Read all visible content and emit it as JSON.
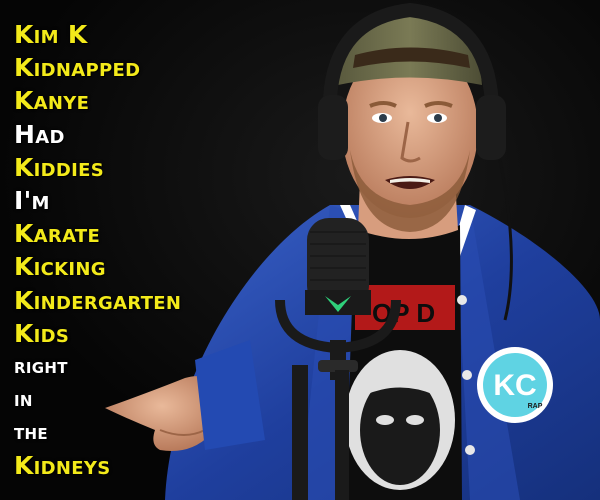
{
  "lyrics": [
    {
      "text": "Kim K",
      "color": "yellow"
    },
    {
      "text": "Kidnapped",
      "color": "yellow"
    },
    {
      "text": "Kanye",
      "color": "yellow"
    },
    {
      "text": "Had",
      "color": "white"
    },
    {
      "text": "Kiddies",
      "color": "yellow"
    },
    {
      "text": "I'm",
      "color": "white"
    },
    {
      "text": "Karate",
      "color": "yellow"
    },
    {
      "text": "Kicking",
      "color": "yellow"
    },
    {
      "text": "Kindergarten",
      "color": "yellow"
    },
    {
      "text": "Kids",
      "color": "yellow"
    },
    {
      "text": "right",
      "color": "white"
    },
    {
      "text": "in",
      "color": "white"
    },
    {
      "text": "the",
      "color": "white"
    },
    {
      "text": "Kidneys",
      "color": "yellow"
    }
  ],
  "colors": {
    "yellow": "#f3ea1a",
    "white": "#ffffff",
    "background": "#0b0b0b",
    "jacket": "#1f3f9e",
    "jacket_light": "#3a62c8"
  },
  "patch": {
    "text": "KC",
    "small": "RAP"
  },
  "shirt_text": "OP D"
}
